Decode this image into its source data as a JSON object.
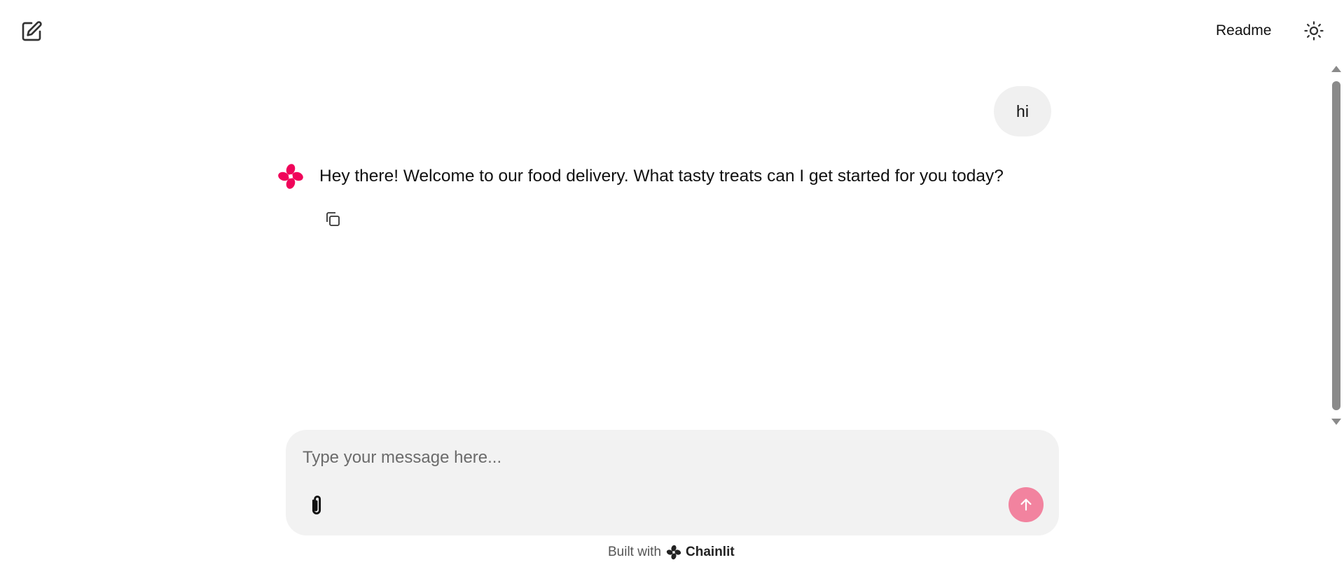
{
  "header": {
    "new_chat_icon": "edit-square-icon",
    "readme_label": "Readme",
    "theme_icon": "sun-icon"
  },
  "messages": [
    {
      "role": "user",
      "text": "hi"
    },
    {
      "role": "assistant",
      "text": "Hey there! Welcome to our food delivery. What tasty treats can I get started for you today?",
      "avatar_icon": "chainlit-logo-icon",
      "action_icon": "copy-icon"
    }
  ],
  "composer": {
    "placeholder": "Type your message here...",
    "value": "",
    "attach_icon": "paperclip-icon",
    "send_icon": "arrow-up-icon"
  },
  "footer": {
    "built_with": "Built with",
    "brand": "Chainlit"
  },
  "colors": {
    "accent": "#f0045a",
    "send_button": "#f2839f",
    "bubble_bg": "#f0f0f0",
    "composer_bg": "#f2f2f2"
  }
}
